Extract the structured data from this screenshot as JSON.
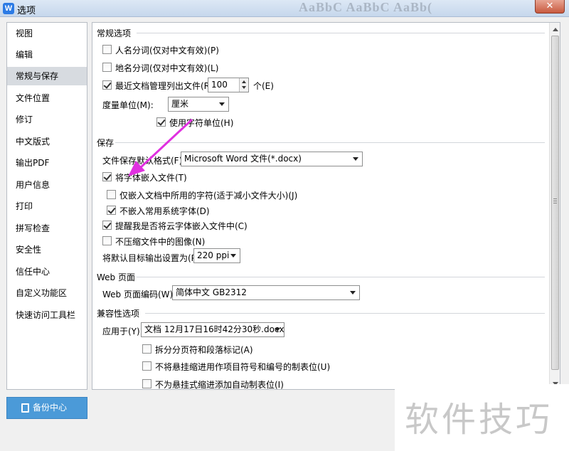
{
  "window": {
    "title": "选项",
    "app_icon_letter": "W",
    "background_title": "AaBbC AaBbC AaBb(",
    "close_glyph": "✕"
  },
  "sidebar": {
    "items": [
      {
        "label": "视图"
      },
      {
        "label": "编辑"
      },
      {
        "label": "常规与保存",
        "active": true
      },
      {
        "label": "文件位置"
      },
      {
        "label": "修订"
      },
      {
        "label": "中文版式"
      },
      {
        "label": "输出PDF"
      },
      {
        "label": "用户信息"
      },
      {
        "label": "打印"
      },
      {
        "label": "拼写检查"
      },
      {
        "label": "安全性"
      },
      {
        "label": "信任中心"
      },
      {
        "label": "自定义功能区"
      },
      {
        "label": "快速访问工具栏"
      }
    ],
    "backup_button": "备份中心"
  },
  "general": {
    "section_title": "常规选项",
    "person_name": {
      "label": "人名分词(仅对中文有效)(P)",
      "checked": false
    },
    "place_name": {
      "label": "地名分词(仅对中文有效)(L)",
      "checked": false
    },
    "recent_files": {
      "label": "最近文档管理列出文件(R):",
      "checked": true,
      "value": "100",
      "unit": "个(E)"
    },
    "measure_unit": {
      "label": "度量单位(M):",
      "value": "厘米"
    },
    "use_char_unit": {
      "label": "使用字符单位(H)",
      "checked": true
    }
  },
  "save": {
    "section_title": "保存",
    "default_format": {
      "label": "文件保存默认格式(F):",
      "value": "Microsoft Word 文件(*.docx)"
    },
    "embed_fonts": {
      "label": "将字体嵌入文件(T)",
      "checked": true
    },
    "embed_used_only": {
      "label": "仅嵌入文档中所用的字符(适于减小文件大小)(J)",
      "checked": false
    },
    "no_common_system": {
      "label": "不嵌入常用系统字体(D)",
      "checked": true
    },
    "remind_cloud_fonts": {
      "label": "提醒我是否将云字体嵌入文件中(C)",
      "checked": true
    },
    "no_compress_images": {
      "label": "不压缩文件中的图像(N)",
      "checked": false
    },
    "default_output": {
      "label": "将默认目标输出设置为(P):",
      "value": "220 ppi"
    }
  },
  "web": {
    "section_title": "Web 页面",
    "encoding": {
      "label": "Web 页面编码(W):",
      "value": "简体中文 GB2312"
    }
  },
  "compat": {
    "section_title": "兼容性选项",
    "apply_to": {
      "label": "应用于(Y):",
      "value": "文档 12月17日16时42分30秒.docx"
    },
    "split_page_marks": {
      "label": "拆分分页符和段落标记(A)",
      "checked": false
    },
    "no_hanging_indent_tab": {
      "label": "不将悬挂缩进用作项目符号和编号的制表位(U)",
      "checked": false
    },
    "no_auto_tab_hanging": {
      "label": "不为悬挂式缩进添加自动制表位(I)",
      "checked": false
    }
  },
  "watermark": "软件技巧",
  "colors": {
    "arrow": "#e030e0",
    "backup_button": "#4b9ad8",
    "active_nav": "#d7dbe0"
  }
}
